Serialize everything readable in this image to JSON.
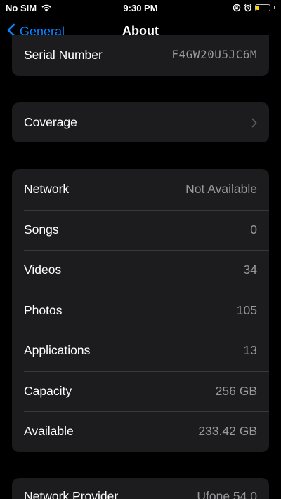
{
  "status_bar": {
    "carrier": "No SIM",
    "time": "9:30 PM",
    "battery_level": 0.3,
    "battery_color": "#ffd60a"
  },
  "nav": {
    "back_label": "General",
    "title": "About",
    "accent_color": "#0a84ff"
  },
  "serial": {
    "label": "Serial Number",
    "value": "F4GW20U5JC6M"
  },
  "coverage": {
    "label": "Coverage",
    "icon": "chevron-right-icon"
  },
  "info_rows": [
    {
      "label": "Network",
      "value": "Not Available"
    },
    {
      "label": "Songs",
      "value": "0"
    },
    {
      "label": "Videos",
      "value": "34"
    },
    {
      "label": "Photos",
      "value": "105"
    },
    {
      "label": "Applications",
      "value": "13"
    },
    {
      "label": "Capacity",
      "value": "256 GB"
    },
    {
      "label": "Available",
      "value": "233.42 GB"
    }
  ],
  "network_provider": {
    "label": "Network Provider",
    "value": "Ufone 54.0"
  }
}
